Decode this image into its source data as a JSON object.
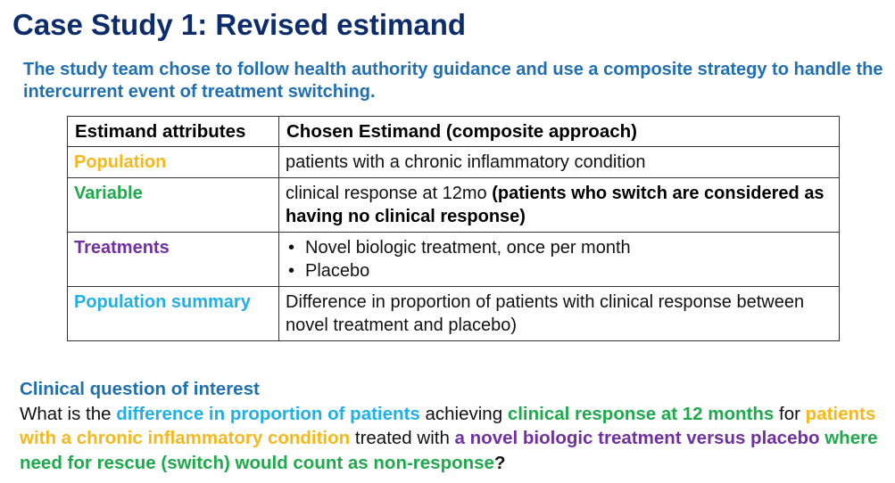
{
  "title": "Case Study 1: Revised estimand",
  "intro": "The study team chose to follow health authority guidance and use a composite strategy to handle the intercurrent event of treatment switching.",
  "colors": {
    "title": "#0d2c6c",
    "intro": "#1f6fb2",
    "population": "#f6b81a",
    "variable": "#1eaa4b",
    "treatments": "#7030a0",
    "population_summary": "#1fb0e6"
  },
  "table": {
    "headers": [
      "Estimand attributes",
      "Chosen Estimand (composite approach)"
    ],
    "rows": {
      "population": {
        "label": "Population",
        "value": "patients with a chronic inflammatory condition"
      },
      "variable": {
        "label": "Variable",
        "value_plain": "clinical response at 12mo ",
        "value_bold": "(patients who switch are considered as having no clinical response)"
      },
      "treatments": {
        "label": "Treatments",
        "items": [
          "Novel biologic treatment, once per month",
          "Placebo"
        ]
      },
      "population_summary": {
        "label": "Population summary",
        "value": "Difference in proportion of patients with clinical response between novel treatment and placebo)"
      }
    }
  },
  "question": {
    "heading": "Clinical question of interest",
    "p1": "What is the ",
    "h1": "difference in proportion of patients",
    "p2": " achieving ",
    "h2": "clinical response at 12 months",
    "p3": " for ",
    "h3": "patients with a chronic inflammatory condition",
    "p4": " treated with ",
    "h4": "a novel biologic treatment versus placebo",
    "p5": " ",
    "h5": "where need for rescue (switch) would count as non-response",
    "p6": "?"
  }
}
